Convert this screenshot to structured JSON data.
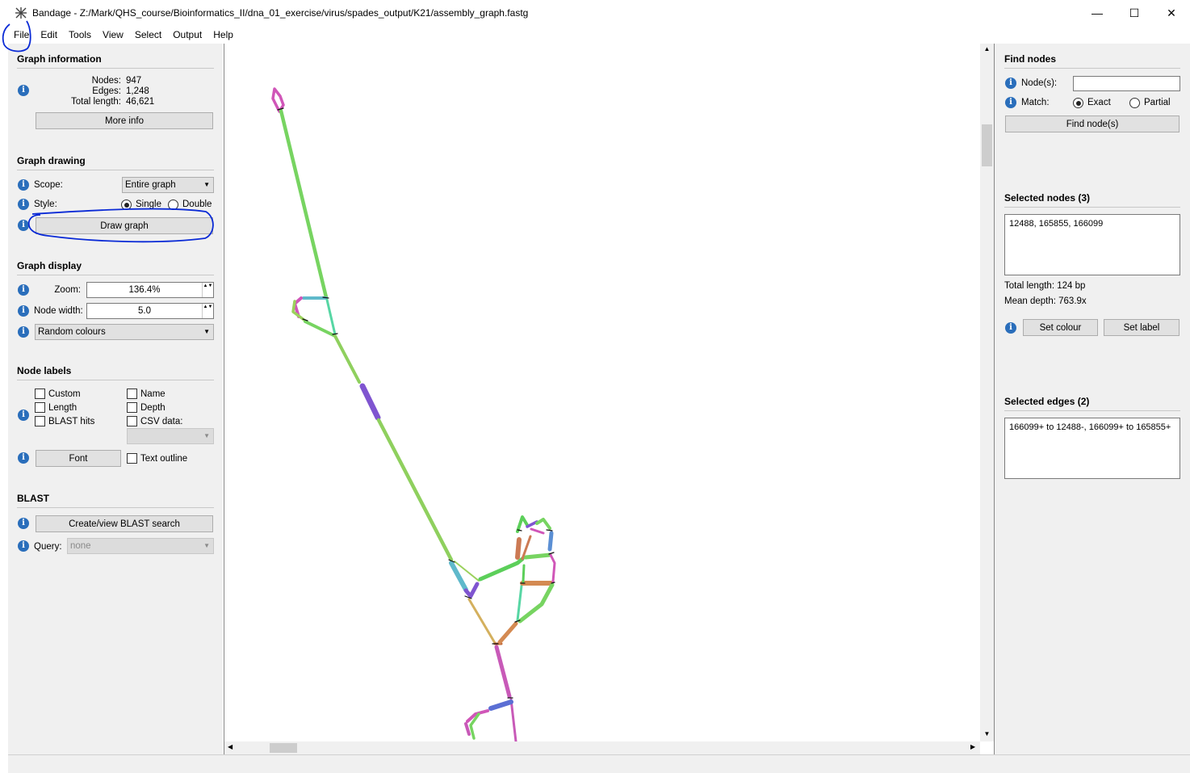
{
  "window": {
    "title": "Bandage - Z:/Mark/QHS_course/Bioinformatics_II/dna_01_exercise/virus/spades_output/K21/assembly_graph.fastg",
    "minimize": "—",
    "maximize": "☐",
    "close": "✕"
  },
  "menu": [
    "File",
    "Edit",
    "Tools",
    "View",
    "Select",
    "Output",
    "Help"
  ],
  "graph_info": {
    "title": "Graph information",
    "nodes_label": "Nodes:",
    "nodes_value": "947",
    "edges_label": "Edges:",
    "edges_value": "1,248",
    "length_label": "Total length:",
    "length_value": "46,621",
    "more_info": "More info"
  },
  "graph_drawing": {
    "title": "Graph drawing",
    "scope_label": "Scope:",
    "scope_value": "Entire graph",
    "style_label": "Style:",
    "style_single": "Single",
    "style_double": "Double",
    "draw_button": "Draw graph"
  },
  "graph_display": {
    "title": "Graph display",
    "zoom_label": "Zoom:",
    "zoom_value": "136.4%",
    "width_label": "Node width:",
    "width_value": "5.0",
    "colour_scheme": "Random colours"
  },
  "node_labels": {
    "title": "Node labels",
    "custom": "Custom",
    "length": "Length",
    "blast_hits": "BLAST hits",
    "name": "Name",
    "depth": "Depth",
    "csv_data": "CSV data:",
    "font_button": "Font",
    "text_outline": "Text outline"
  },
  "blast": {
    "title": "BLAST",
    "create_button": "Create/view BLAST search",
    "query_label": "Query:",
    "query_value": "none"
  },
  "find_nodes": {
    "title": "Find nodes",
    "nodes_label": "Node(s):",
    "match_label": "Match:",
    "exact": "Exact",
    "partial": "Partial",
    "find_button": "Find node(s)"
  },
  "selected_nodes": {
    "title": "Selected nodes (3)",
    "list": "12488, 165855, 166099",
    "total_length": "Total length: 124 bp",
    "mean_depth": "Mean depth: 763.9x",
    "set_colour": "Set colour",
    "set_label": "Set label"
  },
  "selected_edges": {
    "title": "Selected edges (2)",
    "list": "166099+ to 12488-, 166099+ to 165855+"
  },
  "icons": {
    "info": "info-icon",
    "scroll_up": "▲",
    "scroll_down": "▼",
    "scroll_left": "◀",
    "scroll_right": "▶",
    "combo_arrow": "▼",
    "spin_arrows": "▲▼"
  },
  "colors": {
    "info_blue": "#2a6ebb",
    "annotation_blue": "#0a2ad6",
    "panel_bg": "#f0f0f0"
  }
}
